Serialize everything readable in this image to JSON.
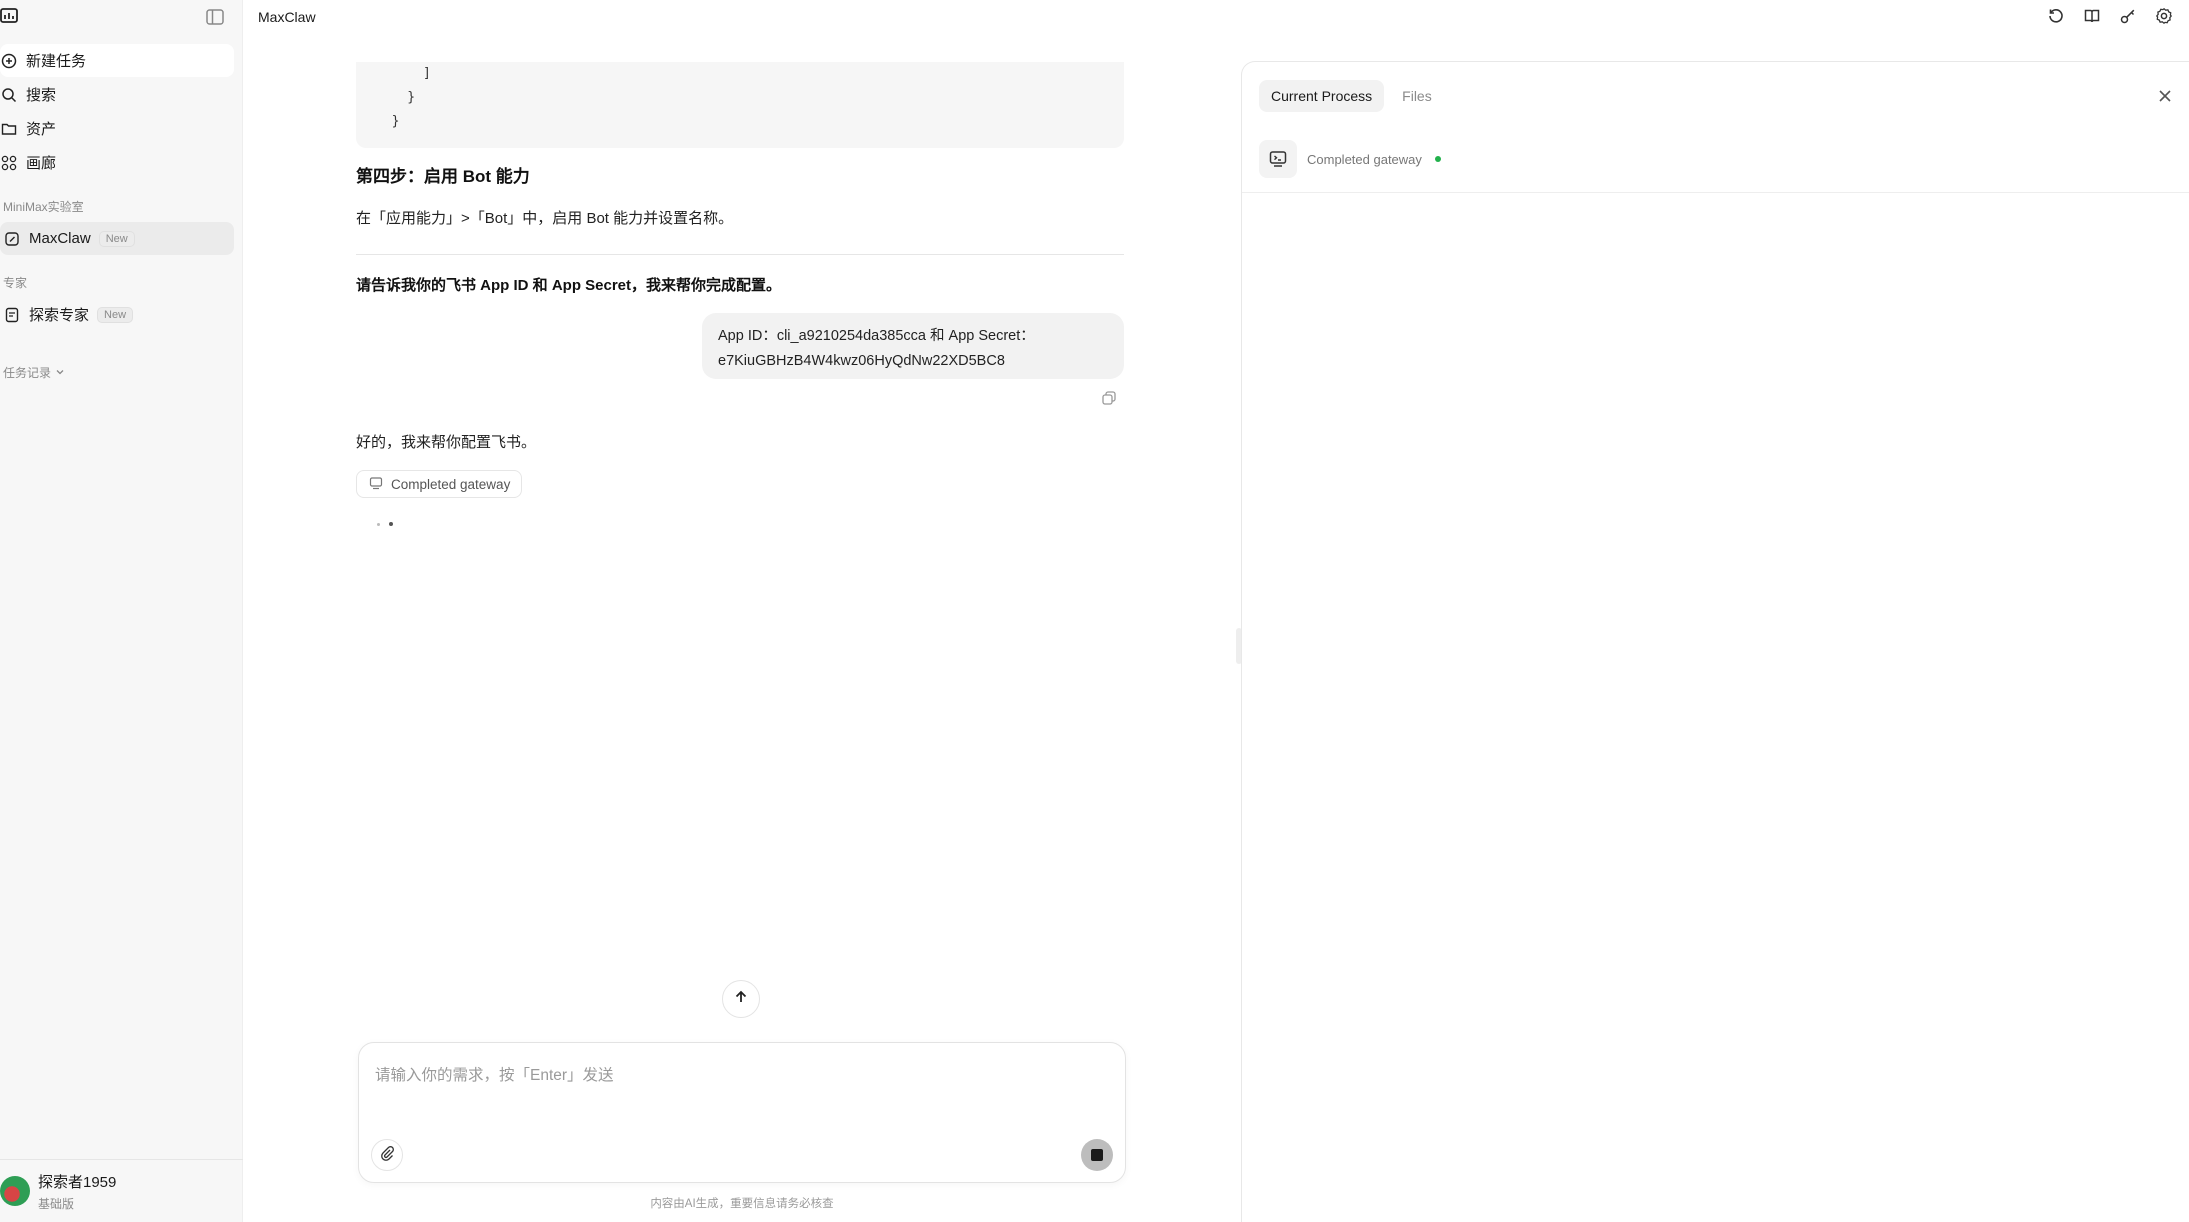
{
  "sidebar": {
    "items": [
      {
        "label": "新建任务",
        "icon": "plus-circle-icon"
      },
      {
        "label": "搜索",
        "icon": "search-icon"
      },
      {
        "label": "资产",
        "icon": "folder-icon"
      },
      {
        "label": "画廊",
        "icon": "grid-icon"
      }
    ],
    "section_lab": "MiniMax实验室",
    "maxclaw": {
      "label": "MaxClaw",
      "badge": "New"
    },
    "section_expert": "专家",
    "expert": {
      "label": "探索专家",
      "badge": "New"
    },
    "task_record": "任务记录",
    "user": {
      "name": "探索者1959",
      "plan": "基础版"
    }
  },
  "header": {
    "title": "MaxClaw"
  },
  "chat": {
    "code_lines": [
      "      ]",
      "    }",
      "  }"
    ],
    "step_title": "第四步：启用 Bot 能力",
    "step_desc": "在「应用能力」>「Bot」中，启用 Bot 能力并设置名称。",
    "ask_text": "请告诉我你的飞书 App ID 和 App Secret，我来帮你完成配置。",
    "user_message_line1": "App ID：cli_a9210254da385cca   和   App Secret：",
    "user_message_line2": "e7KiuGBHzB4W4kwz06HyQdNw22XD5BC8",
    "reply_text": "好的，我来帮你配置飞书。",
    "gateway_chip": "Completed gateway"
  },
  "composer": {
    "placeholder": "请输入你的需求，按「Enter」发送",
    "disclaimer": "内容由AI生成，重要信息请务必核查"
  },
  "panel": {
    "tabs": [
      "Current Process",
      "Files"
    ],
    "active_tab": "Current Process",
    "process_label": "Completed gateway",
    "status_color": "#22b14c"
  }
}
